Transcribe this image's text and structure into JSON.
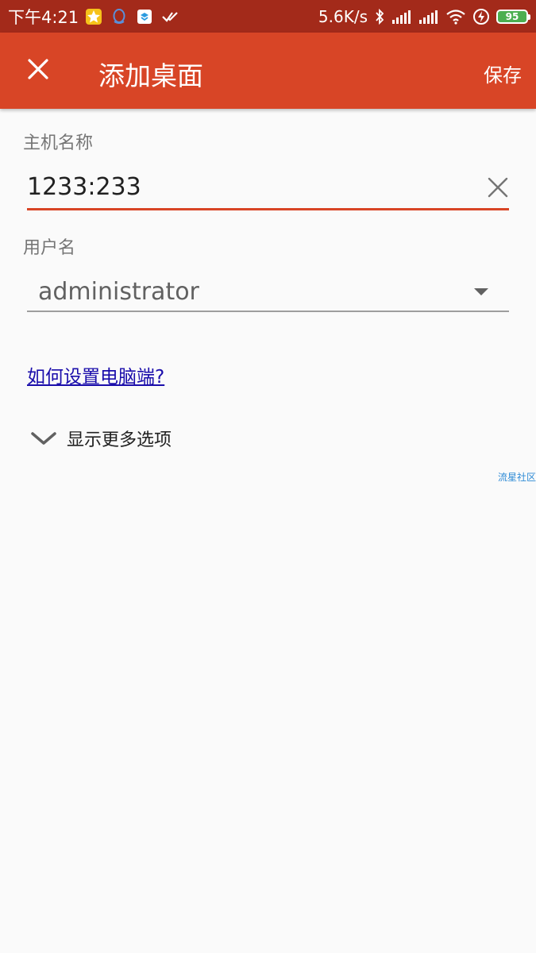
{
  "statusbar": {
    "time": "下午4:21",
    "network_speed": "5.6K/s",
    "battery": "95",
    "icons": [
      "notification-star-icon",
      "qq-icon",
      "app-icon",
      "check-icon",
      "bluetooth-icon",
      "signal-icon",
      "signal-icon",
      "wifi-icon",
      "charging-icon",
      "battery-icon"
    ]
  },
  "appbar": {
    "title": "添加桌面",
    "save_label": "保存",
    "close_icon": "close-icon"
  },
  "form": {
    "host_label": "主机名称",
    "host_value": "1233:233",
    "username_label": "用户名",
    "username_value": "administrator"
  },
  "help_link": "如何设置电脑端?",
  "more_options_label": "显示更多选项",
  "watermark": "流星社区",
  "colors": {
    "statusbar": "#a32a1a",
    "appbar": "#d84526",
    "accent": "#d84526",
    "background": "#fafafa",
    "link": "#1a0dab"
  }
}
